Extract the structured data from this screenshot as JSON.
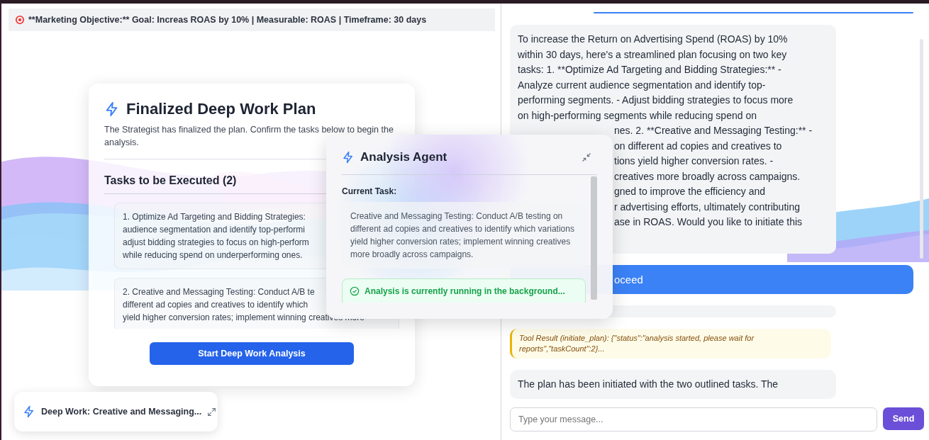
{
  "objective_bar": {
    "text": "**Marketing Objective:** Goal: Increas ROAS by 10% | Measurable: ROAS | Timeframe: 30 days"
  },
  "plan_card": {
    "title": "Finalized Deep Work Plan",
    "description": "The Strategist has finalized the plan. Confirm the tasks below to begin the analysis.",
    "tasks_heading": "Tasks to be Executed (2)",
    "tasks": [
      {
        "lines": [
          "1. Optimize Ad Targeting and Bidding Strategies:",
          "audience segmentation and identify top-performi",
          "adjust bidding strategies to focus on high-perform",
          "while reducing spend on underperforming ones."
        ]
      },
      {
        "lines": [
          "2. Creative and Messaging Testing: Conduct A/B te",
          "different ad copies and creatives to identify which",
          "yield higher conversion rates; implement winning creatives more"
        ]
      }
    ],
    "start_button": "Start Deep Work Analysis"
  },
  "analysis_panel": {
    "title": "Analysis Agent",
    "current_task_label": "Current Task:",
    "current_task": "Creative and Messaging Testing: Conduct A/B testing on different ad copies and creatives to identify which variations yield higher conversion rates; implement winning creatives more broadly across campaigns.",
    "status": "Analysis is currently running in the background..."
  },
  "minimized_chip": {
    "label": "Deep Work: Creative and Messaging..."
  },
  "chat": {
    "messages": [
      {
        "kind": "user"
      },
      {
        "kind": "assistant",
        "lines": [
          "To increase the Return on Advertising Spend (ROAS) by 10%",
          "within 30 days, here's a streamlined plan focusing on two key",
          "tasks: 1. **Optimize Ad Targeting and Bidding Strategies:** -",
          "Analyze current audience segmentation and identify top-",
          "performing segments. - Adjust bidding strategies to focus more",
          "on high-performing segments while reducing spend on"
        ],
        "covered_lines": [
          "nes. 2. **Creative and Messaging Testing:** -",
          "on different ad copies and creatives to",
          "tions yield higher conversion rates. -",
          "creatives more broadly across campaigns.",
          "gned to improve the efficiency and",
          "r advertising efforts, ultimately contributing",
          "ase in ROAS. Would you like to initiate this"
        ]
      },
      {
        "kind": "user",
        "covered_lines": [
          "oceed"
        ]
      },
      {
        "kind": "assistant"
      },
      {
        "kind": "tool",
        "lines": [
          "Tool Result (initiate_plan): {\"status\":\"analysis started, please wait for",
          "reports\",\"taskCount\":2}..."
        ]
      },
      {
        "kind": "assistant",
        "lines": [
          "The plan has been initiated with the two outlined tasks. The"
        ]
      }
    ],
    "input": {
      "placeholder": "Type your message..."
    },
    "send_button": "Send"
  }
}
